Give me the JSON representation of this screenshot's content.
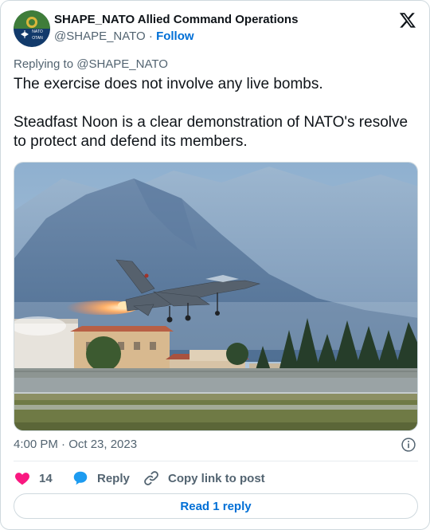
{
  "author": {
    "name": "SHAPE_NATO Allied Command Operations",
    "handle": "@SHAPE_NATO",
    "separator": "·",
    "follow_label": "Follow",
    "avatar_text_top": "NATO",
    "avatar_text_bottom": "OTAN"
  },
  "reply_to": "Replying to @SHAPE_NATO",
  "tweet": {
    "paragraphs": [
      "The exercise does not involve any live bombs.",
      "Steadfast Noon is a clear demonstration of NATO's resolve to protect and defend its members."
    ]
  },
  "media": {
    "alt": "F-16 fighter jet taking off with afterburner, mountains in background"
  },
  "timestamp": "4:00 PM · Oct 23, 2023",
  "actions": {
    "like_count": "14",
    "reply_label": "Reply",
    "copy_label": "Copy link to post"
  },
  "read_reply_label": "Read 1 reply",
  "colors": {
    "link": "#006fd6",
    "like": "#f91880",
    "reply": "#1d9bf0",
    "secondary_text": "#536471"
  },
  "icons": [
    "x-logo-icon",
    "info-icon",
    "heart-icon",
    "reply-bubble-icon",
    "link-icon"
  ]
}
